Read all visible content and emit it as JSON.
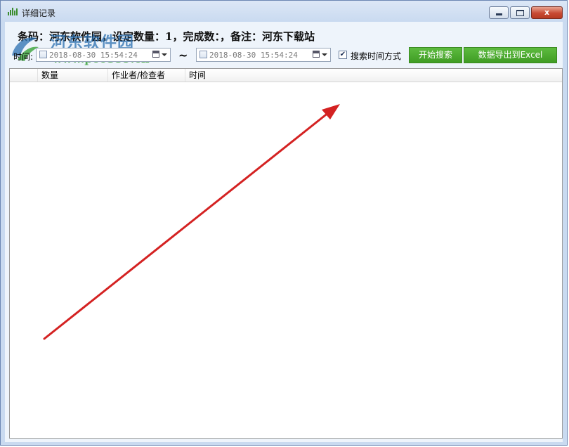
{
  "window": {
    "title": "详细记录",
    "minimize_label": "",
    "maximize_label": "",
    "close_label": "x"
  },
  "info": {
    "line": "条码：河东软件园，设定数量：1，完成数：，备注：河东下载站"
  },
  "watermark": {
    "name": "河东软件园",
    "url": "www.pc0359.cn"
  },
  "filter": {
    "time_label": "时间:",
    "start_value": "2018-08-30 15:54:24",
    "end_value": "2018-08-30 15:54:24",
    "range_separator": "~",
    "search_time_mode_label": "搜索时间方式",
    "search_time_mode_checked": true,
    "search_button": "开始搜索",
    "export_button": "数据导出到Excel"
  },
  "grid": {
    "columns": [
      "",
      "数量",
      "作业者/检查者",
      "时间"
    ],
    "rows": []
  },
  "colors": {
    "accent_green": "#46a52a",
    "arrow_red": "#d42222",
    "window_bg": "#c9daf0"
  }
}
